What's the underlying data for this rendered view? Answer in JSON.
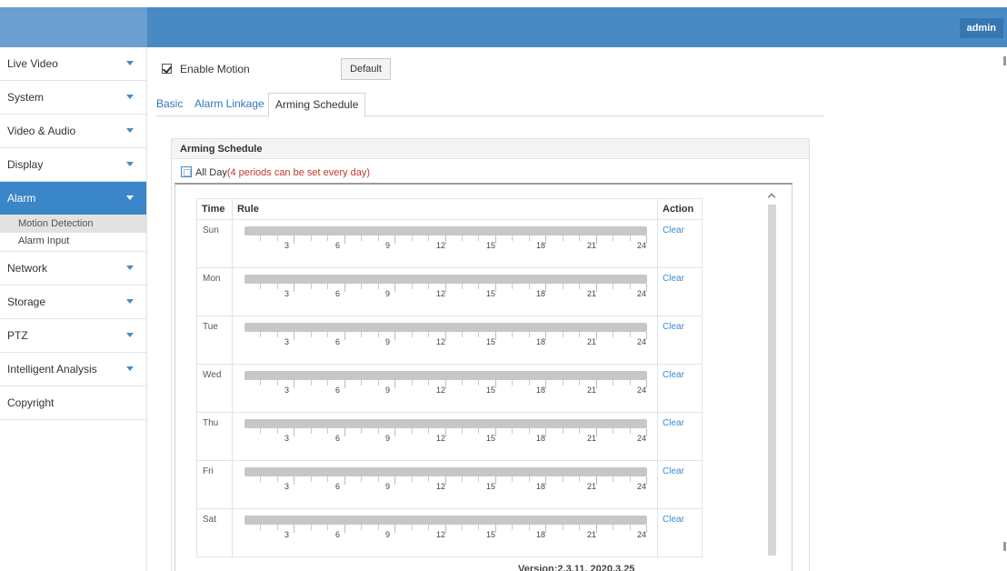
{
  "header": {
    "user_label": "admin"
  },
  "sidebar": {
    "items": [
      {
        "label": "Live Video"
      },
      {
        "label": "System"
      },
      {
        "label": "Video & Audio"
      },
      {
        "label": "Display"
      },
      {
        "label": "Alarm",
        "active": true,
        "children": [
          {
            "label": "Motion Detection",
            "selected": true
          },
          {
            "label": "Alarm Input"
          }
        ]
      },
      {
        "label": "Network"
      },
      {
        "label": "Storage"
      },
      {
        "label": "PTZ"
      },
      {
        "label": "Intelligent Analysis"
      },
      {
        "label": "Copyright"
      }
    ]
  },
  "main": {
    "enable_motion": {
      "label": "Enable Motion",
      "checked": true
    },
    "default_button": "Default",
    "tabs": [
      {
        "label": "Basic"
      },
      {
        "label": "Alarm Linkage"
      },
      {
        "label": "Arming Schedule",
        "active": true
      }
    ],
    "panel_title": "Arming Schedule",
    "all_day": {
      "label": "All Day",
      "note": "(4 periods can be set every day)",
      "checked": false
    },
    "table": {
      "headers": {
        "time": "Time",
        "rule": "Rule",
        "action": "Action"
      },
      "tick_labels": [
        "3",
        "6",
        "9",
        "12",
        "15",
        "18",
        "21",
        "24"
      ],
      "days": [
        {
          "day": "Sun",
          "action": "Clear"
        },
        {
          "day": "Mon",
          "action": "Clear"
        },
        {
          "day": "Tue",
          "action": "Clear"
        },
        {
          "day": "Wed",
          "action": "Clear"
        },
        {
          "day": "Thu",
          "action": "Clear"
        },
        {
          "day": "Fri",
          "action": "Clear"
        },
        {
          "day": "Sat",
          "action": "Clear"
        }
      ]
    }
  },
  "footer": {
    "version": "Version:2.3.11, 2020.3.25"
  },
  "colors": {
    "header_bg": "#4a8ac4",
    "accent": "#3a86c8",
    "link": "#3b8ad0",
    "note": "#c0392b",
    "bar": "#c7c7c7"
  }
}
